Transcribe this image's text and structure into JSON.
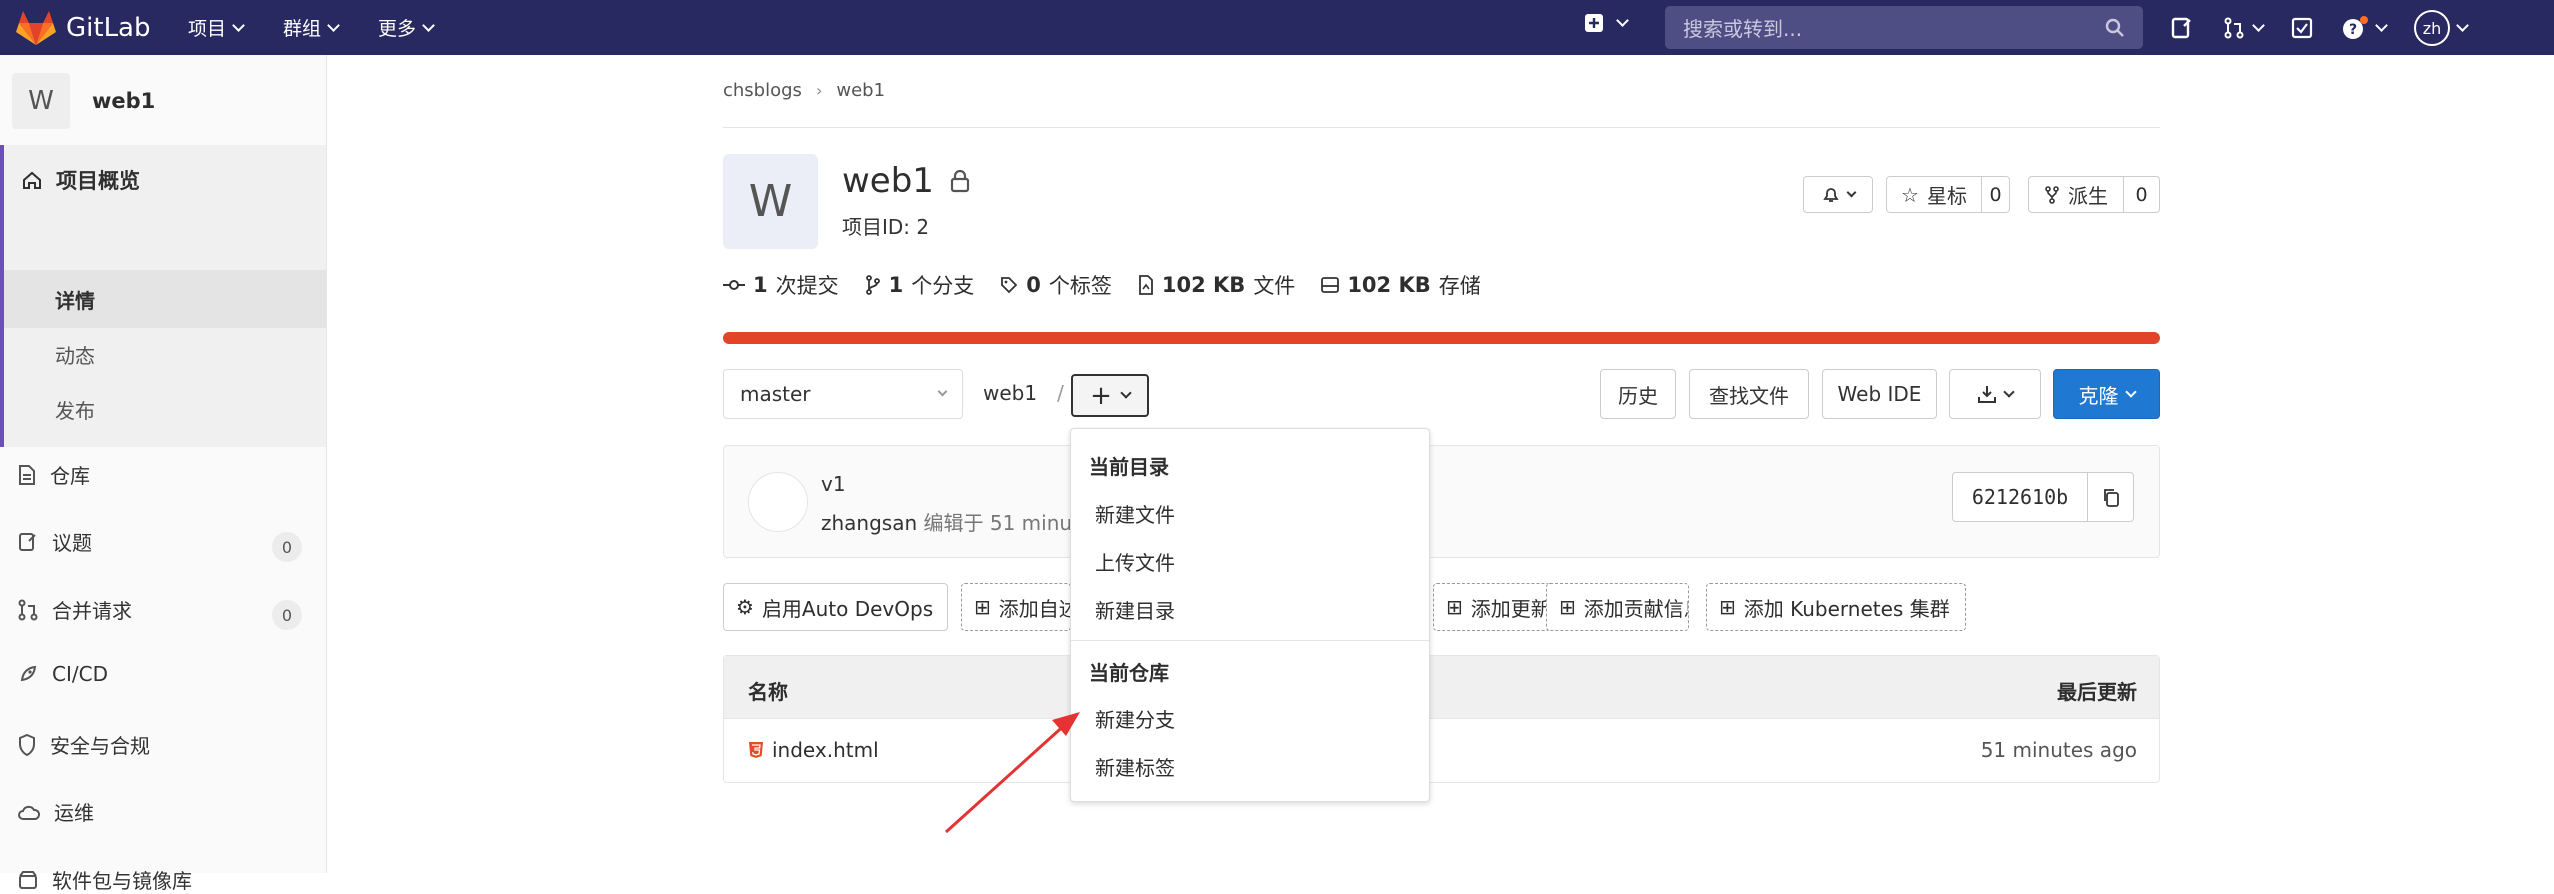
{
  "topbar": {
    "brand": "GitLab",
    "nav": [
      "项目",
      "群组",
      "更多"
    ],
    "search_placeholder": "搜索或转到...",
    "user_initials": "zh"
  },
  "sidebar": {
    "project_letter": "W",
    "project_name": "web1",
    "overview": {
      "label": "项目概览",
      "subitems": [
        "详情",
        "动态",
        "发布"
      ]
    },
    "items": [
      {
        "label": "仓库",
        "icon": "doc-icon"
      },
      {
        "label": "议题",
        "icon": "issues-icon",
        "count": "0"
      },
      {
        "label": "合并请求",
        "icon": "merge-request-icon",
        "count": "0"
      },
      {
        "label": "CI/CD",
        "icon": "rocket-icon"
      },
      {
        "label": "安全与合规",
        "icon": "shield-icon"
      },
      {
        "label": "运维",
        "icon": "cloud-icon"
      },
      {
        "label": "软件包与镜像库",
        "icon": "package-icon"
      }
    ]
  },
  "breadcrumb": [
    "chsblogs",
    "web1"
  ],
  "project": {
    "letter": "W",
    "name": "web1",
    "id_text": "项目ID: 2",
    "star_label": "星标",
    "star_count": "0",
    "fork_label": "派生",
    "fork_count": "0"
  },
  "stats": {
    "commits_num": "1",
    "commits_label": "次提交",
    "branches_num": "1",
    "branches_label": "个分支",
    "tags_num": "0",
    "tags_label": "个标签",
    "files_num": "102 KB",
    "files_label": "文件",
    "storage_num": "102 KB",
    "storage_label": "存储"
  },
  "language_bar": {
    "color": "#e24329",
    "percent": 100
  },
  "repo": {
    "branch": "master",
    "path": "web1",
    "separator": "/",
    "buttons": {
      "history": "历史",
      "find_file": "查找文件",
      "web_ide": "Web IDE",
      "clone": "克隆"
    }
  },
  "commit": {
    "title": "v1",
    "author": "zhangsan",
    "edited": "编辑于 51 minutes ago",
    "sha": "6212610b"
  },
  "actions": {
    "auto_devops": "启用Auto DevOps",
    "add_readme": "添加自述文件",
    "add_changelog": "添加更新日志",
    "add_contributing": "添加贡献信息",
    "add_kubernetes": "添加 Kubernetes 集群"
  },
  "table": {
    "col_name": "名称",
    "col_updated": "最后更新",
    "rows": [
      {
        "name": "index.html",
        "updated": "51 minutes ago"
      }
    ]
  },
  "dropdown": {
    "section1": "当前目录",
    "items1": [
      "新建文件",
      "上传文件",
      "新建目录"
    ],
    "section2": "当前仓库",
    "items2": [
      "新建分支",
      "新建标签"
    ]
  },
  "colors": {
    "topbar": "#292961",
    "accent": "#6b4fbb",
    "clone_btn": "#1f78d1",
    "annotation_arrow": "#e53232"
  }
}
